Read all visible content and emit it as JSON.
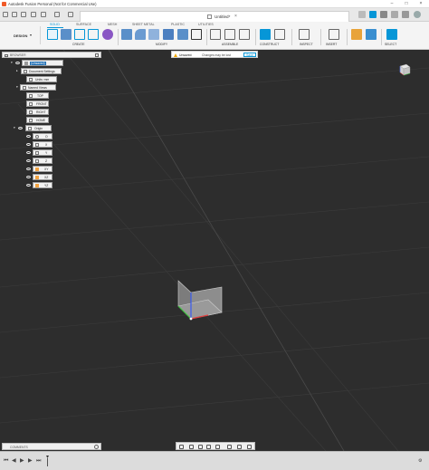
{
  "window": {
    "title": "Autodesk Fusion Personal (Not for Commercial Use)"
  },
  "document": {
    "tab_title": "Untitled*"
  },
  "toolbar": {
    "workspace": "DESIGN",
    "workspace_tabs": [
      "SOLID",
      "SURFACE",
      "MESH",
      "SHEET METAL",
      "PLASTIC",
      "UTILITIES"
    ],
    "groups": [
      "CREATE",
      "MODIFY",
      "ASSEMBLE",
      "CONSTRUCT",
      "INSPECT",
      "INSERT",
      "SELECT"
    ]
  },
  "browser": {
    "header": "BROWSER",
    "root": "(Unsaved)",
    "document_settings": "Document Settings",
    "units": "Units: mm",
    "named_views": "Named Views",
    "views": [
      "TOP",
      "FRONT",
      "RIGHT",
      "HOME"
    ],
    "origin": "Origin",
    "origin_items": [
      "O",
      "X",
      "Y",
      "Z",
      "XY",
      "XZ",
      "YZ"
    ]
  },
  "warning": {
    "title": "Unsaved:",
    "message": "Changes may be lost",
    "save_label": "Save"
  },
  "comments": {
    "label": "COMMENTS"
  },
  "colors": {
    "accent": "#0696d7",
    "viewport": "#2d2d2d",
    "warning": "#f2a900",
    "origin_plane": "#f2a341",
    "brand": "#f05a28"
  }
}
